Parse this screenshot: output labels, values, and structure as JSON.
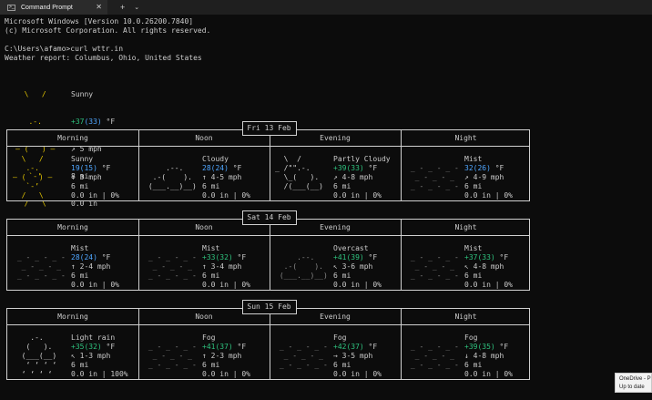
{
  "titlebar": {
    "tab_title": "Command Prompt",
    "close_glyph": "✕",
    "new_tab_glyph": "+",
    "dropdown_glyph": "⌄"
  },
  "terminal": {
    "lines": [
      "Microsoft Windows [Version 10.0.26200.7840]",
      "(c) Microsoft Corporation. All rights reserved.",
      "",
      "C:\\Users\\afamo>curl wttr.in",
      "Weather report: Columbus, Ohio, United States"
    ]
  },
  "current": {
    "art": [
      "  \\   /  ",
      "   .-.   ",
      "― (   ) ―",
      "   `-’   ",
      "  /   \\  "
    ],
    "condition": "Sunny",
    "temp_main": "+37",
    "temp_feels": "(33)",
    "temp_unit": " °F",
    "wind": "↗ 5 mph",
    "visibility": "8 mi",
    "precip": "0.0 in"
  },
  "columns": [
    "Morning",
    "Noon",
    "Evening",
    "Night"
  ],
  "days": [
    {
      "label": "Fri 13 Feb",
      "cells": [
        {
          "art": [
            "  \\   /  ",
            "   .-.   ",
            "― (   ) ―",
            "   `-’   ",
            "  /   \\  "
          ],
          "art_color": "#e6c700",
          "condition": "Sunny",
          "temp": "19(15)",
          "temp_color": "#4fa6ff",
          "unit": " °F",
          "wind": "↑ 3 mph",
          "vis": "6 mi",
          "precip": "0.0 in | 0%"
        },
        {
          "art": [
            "",
            "     .--.    ",
            "  .-(    ).  ",
            " (___.__)__) ",
            ""
          ],
          "art_color": "#d7d7d7",
          "condition": "Cloudy",
          "temp": "28(24)",
          "temp_color": "#4fa6ff",
          "unit": " °F",
          "wind": "↑ 4-5 mph",
          "vis": "6 mi",
          "precip": "0.0 in | 0%"
        },
        {
          "art": [
            "  \\  /",
            "_ /\"\".-.  ",
            "  \\_(   ). ",
            "  /(___(__)",
            ""
          ],
          "art_color": "#d7d7d7",
          "condition": "Partly Cloudy",
          "temp": "+39(33)",
          "temp_color": "#2ec27e",
          "unit": " °F",
          "wind": "↗ 4-8 mph",
          "vis": "6 mi",
          "precip": "0.0 in | 0%"
        },
        {
          "art": [
            "",
            " _ - _ - _ -",
            "  _ - _ - _ ",
            " _ - _ - _ -",
            ""
          ],
          "art_color": "#8a8a8a",
          "condition": "Mist",
          "temp": "32(26)",
          "temp_color": "#4fa6ff",
          "unit": " °F",
          "wind": "↗ 4-9 mph",
          "vis": "6 mi",
          "precip": "0.0 in | 0%"
        }
      ]
    },
    {
      "label": "Sat 14 Feb",
      "cells": [
        {
          "art": [
            "",
            " _ - _ - _ -",
            "  _ - _ - _ ",
            " _ - _ - _ -",
            ""
          ],
          "art_color": "#8a8a8a",
          "condition": "Mist",
          "temp": "28(24)",
          "temp_color": "#4fa6ff",
          "unit": " °F",
          "wind": "↑ 2-4 mph",
          "vis": "6 mi",
          "precip": "0.0 in | 0%"
        },
        {
          "art": [
            "",
            " _ - _ - _ -",
            "  _ - _ - _ ",
            " _ - _ - _ -",
            ""
          ],
          "art_color": "#8a8a8a",
          "condition": "Mist",
          "temp": "+33(32)",
          "temp_color": "#2ec27e",
          "unit": " °F",
          "wind": "↑ 3-4 mph",
          "vis": "6 mi",
          "precip": "0.0 in | 0%"
        },
        {
          "art": [
            "",
            "     .--.    ",
            "  .-(    ).  ",
            " (___.__)__) ",
            ""
          ],
          "art_color": "#8a8a8a",
          "condition": "Overcast",
          "temp": "+41(39)",
          "temp_color": "#2ec27e",
          "unit": " °F",
          "wind": "↖ 3-6 mph",
          "vis": "6 mi",
          "precip": "0.0 in | 0%"
        },
        {
          "art": [
            "",
            " _ - _ - _ -",
            "  _ - _ - _ ",
            " _ - _ - _ -",
            ""
          ],
          "art_color": "#8a8a8a",
          "condition": "Mist",
          "temp": "+37(33)",
          "temp_color": "#2ec27e",
          "unit": " °F",
          "wind": "↖ 4-8 mph",
          "vis": "6 mi",
          "precip": "0.0 in | 0%"
        }
      ]
    },
    {
      "label": "Sun 15 Feb",
      "cells": [
        {
          "art": [
            "    .-.   ",
            "   (   ).  ",
            "  (___(__) ",
            "   ‘ ‘ ‘ ‘ ",
            "  ‘ ‘ ‘ ‘  "
          ],
          "art_color": "#d7d7d7",
          "condition": "Light rain",
          "temp": "+35(32)",
          "temp_color": "#2ec27e",
          "unit": " °F",
          "wind": "↖ 1-3 mph",
          "vis": "6 mi",
          "precip": "0.0 in | 100%"
        },
        {
          "art": [
            "",
            " _ - _ - _ -",
            "  _ - _ - _ ",
            " _ - _ - _ -",
            ""
          ],
          "art_color": "#8a8a8a",
          "condition": "Fog",
          "temp": "+41(37)",
          "temp_color": "#2ec27e",
          "unit": " °F",
          "wind": "↑ 2-3 mph",
          "vis": "6 mi",
          "precip": "0.0 in | 0%"
        },
        {
          "art": [
            "",
            " _ - _ - _ -",
            "  _ - _ - _ ",
            " _ - _ - _ -",
            ""
          ],
          "art_color": "#8a8a8a",
          "condition": "Fog",
          "temp": "+42(37)",
          "temp_color": "#2ec27e",
          "unit": " °F",
          "wind": "→ 3-5 mph",
          "vis": "6 mi",
          "precip": "0.0 in | 0%"
        },
        {
          "art": [
            "",
            " _ - _ - _ -",
            "  _ - _ - _ ",
            " _ - _ - _ -",
            ""
          ],
          "art_color": "#8a8a8a",
          "condition": "Fog",
          "temp": "+39(35)",
          "temp_color": "#2ec27e",
          "unit": " °F",
          "wind": "↓ 4-8 mph",
          "vis": "6 mi",
          "precip": "0.0 in | 0%"
        }
      ]
    }
  ],
  "onedrive_popup": {
    "line1": "OneDrive - P",
    "line2": "Up to date"
  }
}
